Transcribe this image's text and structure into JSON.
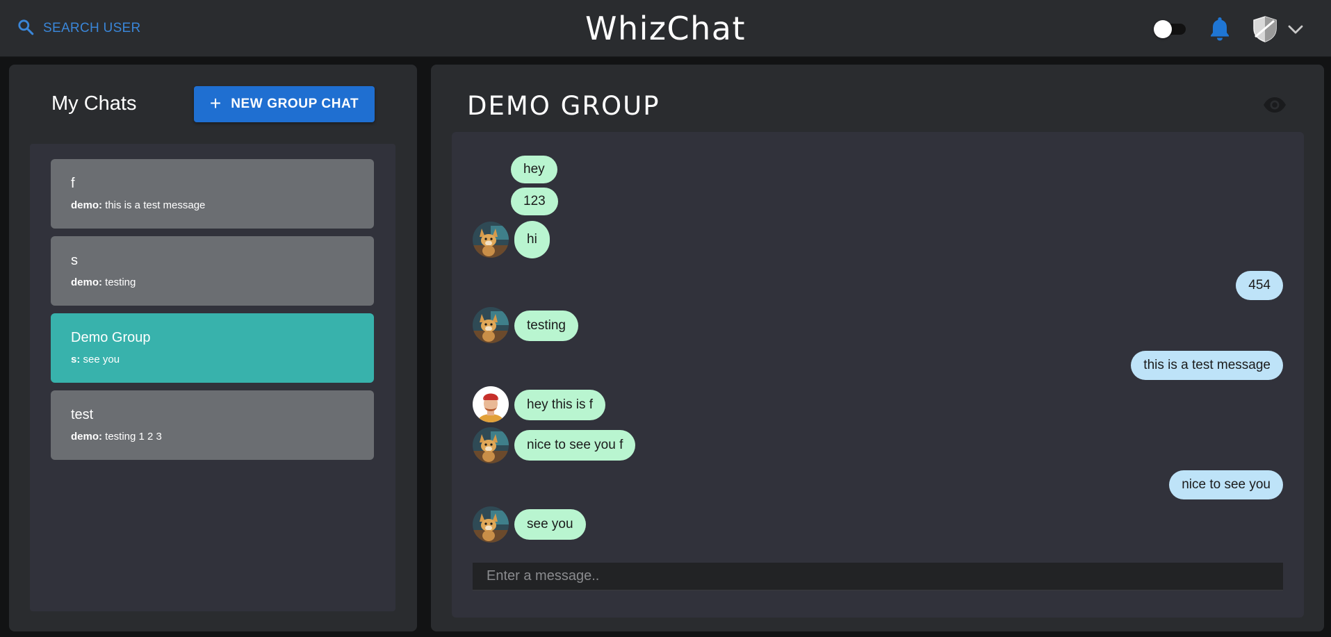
{
  "header": {
    "search_label": "Search User",
    "app_title": "WhizChat",
    "icons": {
      "search": "search-icon",
      "theme_toggle": "toggle-switch",
      "notifications": "bell-icon",
      "profile": "shield-avatar-icon",
      "menu": "chevron-down-icon"
    },
    "accent_color": "#3a86d8"
  },
  "sidebar": {
    "title": "My Chats",
    "new_group_button": {
      "icon": "+",
      "label": "NEW GROUP CHAT"
    },
    "chats": [
      {
        "name": "f",
        "sender": "demo:",
        "preview": "this is a test message",
        "active": false
      },
      {
        "name": "s",
        "sender": "demo:",
        "preview": "testing",
        "active": false
      },
      {
        "name": "Demo Group",
        "sender": "s:",
        "preview": "see you",
        "active": true
      },
      {
        "name": "test",
        "sender": "demo:",
        "preview": "testing 1 2 3",
        "active": false
      }
    ],
    "active_color": "#38b2ac"
  },
  "conversation": {
    "title": "DEMO GROUP",
    "view_icon": "eye-icon",
    "messages": [
      {
        "text": "hey",
        "from": "other"
      },
      {
        "text": "123",
        "from": "other"
      },
      {
        "text": "hi",
        "from": "other",
        "avatar": "fox-avatar"
      },
      {
        "text": "454",
        "from": "me"
      },
      {
        "text": "testing",
        "from": "other",
        "avatar": "fox-avatar"
      },
      {
        "text": "this is a test message",
        "from": "me"
      },
      {
        "text": "hey this is f",
        "from": "other",
        "avatar": "person-avatar"
      },
      {
        "text": "nice to see you f",
        "from": "other",
        "avatar": "fox-avatar"
      },
      {
        "text": "nice to see you",
        "from": "me"
      },
      {
        "text": "see you",
        "from": "other",
        "avatar": "fox-avatar"
      }
    ],
    "input_placeholder": "Enter a message..",
    "other_bubble_color": "#b9f5d0",
    "my_bubble_color": "#bee3f8"
  }
}
